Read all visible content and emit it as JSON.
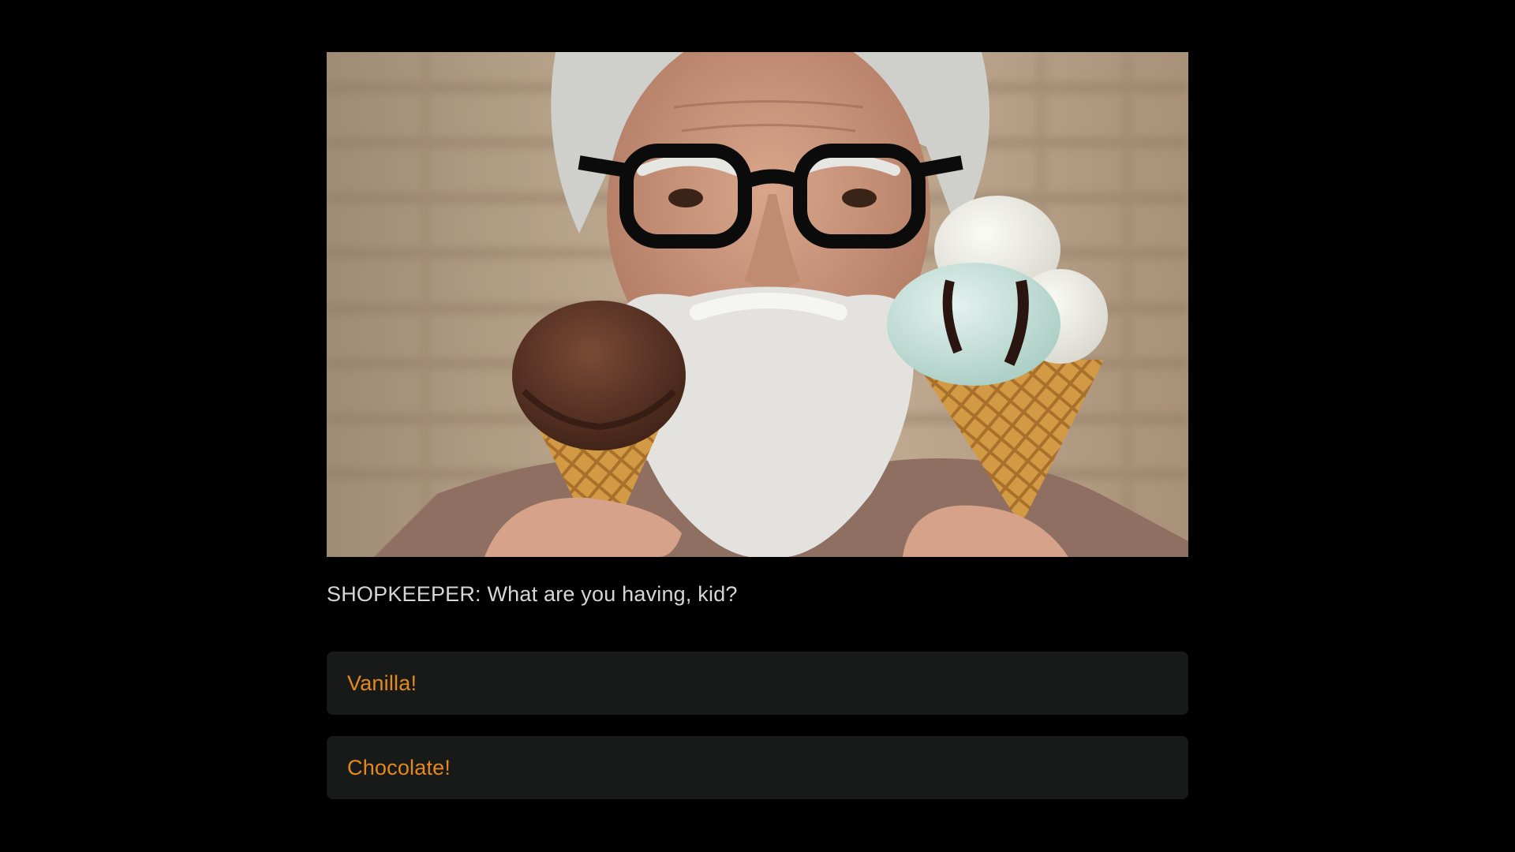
{
  "scene": {
    "image_subject": "shopkeeper-holding-ice-cream-cones"
  },
  "dialogue": {
    "speaker": "SHOPKEEPER",
    "line": "SHOPKEEPER: What are you having, kid?"
  },
  "choices": [
    {
      "label": "Vanilla!"
    },
    {
      "label": "Chocolate!"
    }
  ],
  "colors": {
    "background": "#000000",
    "choice_background": "#181a1a",
    "choice_text": "#e58a1a",
    "dialogue_text": "#d6d6d6"
  }
}
